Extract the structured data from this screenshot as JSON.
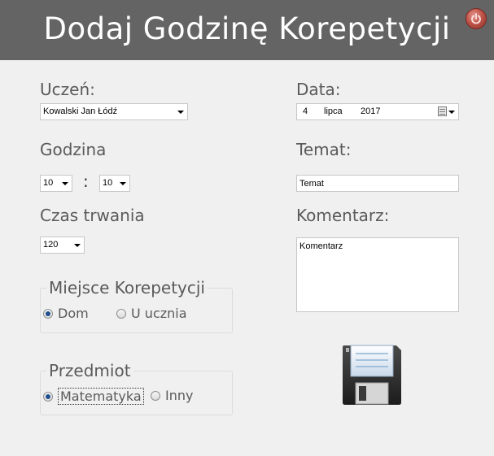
{
  "header": {
    "title": "Dodaj Godzinę Korepetycji",
    "power_icon": "power-icon"
  },
  "student": {
    "label": "Uczeń:",
    "selected": "Kowalski Jan Łódź"
  },
  "date": {
    "label": "Data:",
    "day": "4",
    "month": "lipca",
    "year": "2017"
  },
  "time": {
    "label": "Godzina",
    "hour": "10",
    "separator": ":",
    "minute": "10"
  },
  "topic": {
    "label": "Temat:",
    "value": "Temat"
  },
  "duration": {
    "label": "Czas trwania",
    "selected": "120"
  },
  "comment": {
    "label": "Komentarz:",
    "value": "Komentarz"
  },
  "place": {
    "title": "Miejsce Korepetycji",
    "options": [
      {
        "label": "Dom",
        "checked": true
      },
      {
        "label": "U ucznia",
        "checked": false
      }
    ]
  },
  "subject": {
    "title": "Przedmiot",
    "options": [
      {
        "label": "Matematyka",
        "checked": true
      },
      {
        "label": "Inny",
        "checked": false
      }
    ]
  },
  "save": {
    "icon": "floppy-disk-icon"
  },
  "colors": {
    "header_bg": "#646464",
    "window_bg": "#f0f0f0",
    "power_button": "#c0554b",
    "radio_checked": "#1e4e8c"
  }
}
